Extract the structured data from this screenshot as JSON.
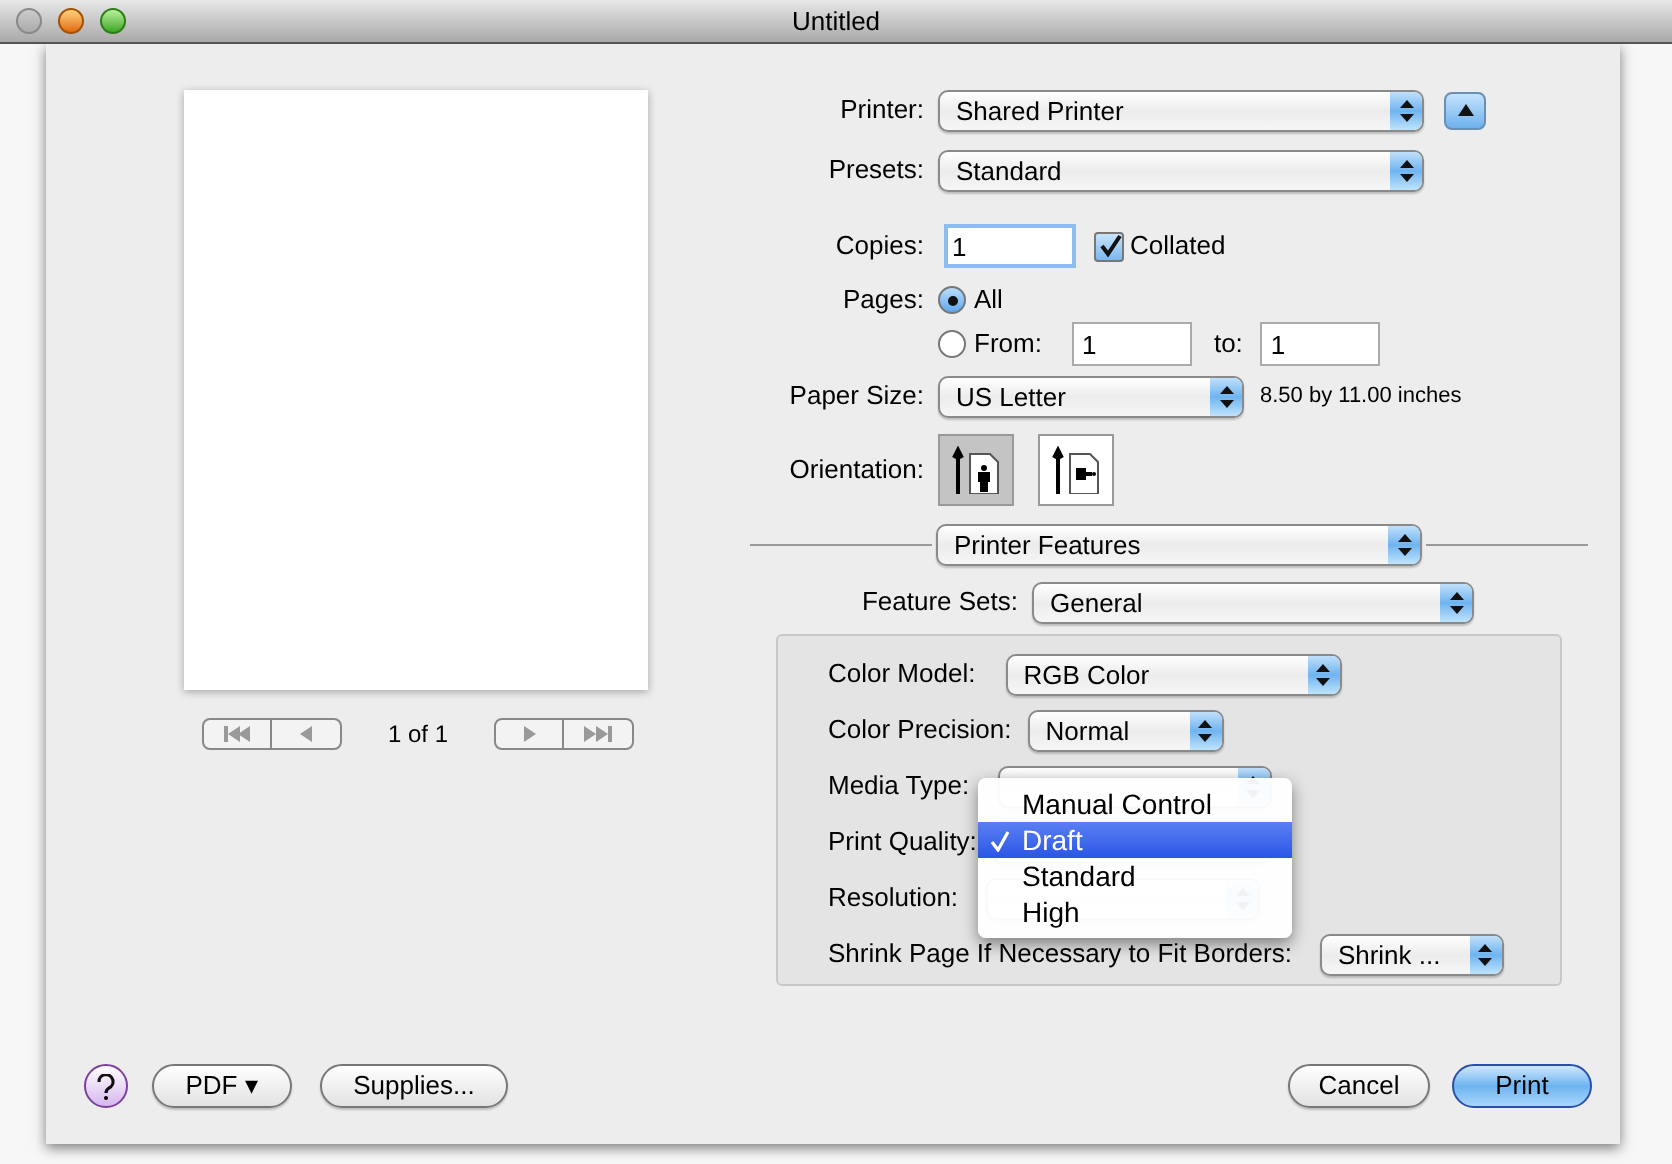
{
  "window": {
    "title": "Untitled"
  },
  "preview": {
    "page_indicator": "1 of 1"
  },
  "printer": {
    "label": "Printer:",
    "value": "Shared Printer"
  },
  "presets": {
    "label": "Presets:",
    "value": "Standard"
  },
  "copies": {
    "label": "Copies:",
    "value": "1"
  },
  "collated": {
    "label": "Collated",
    "checked": true
  },
  "pages": {
    "label": "Pages:",
    "options": [
      {
        "label": "All",
        "selected": true
      },
      {
        "label": "From:",
        "selected": false
      }
    ],
    "from_value": "1",
    "to_label": "to:",
    "to_value": "1"
  },
  "paper_size": {
    "label": "Paper Size:",
    "value": "US Letter",
    "dimensions": "8.50 by 11.00 inches"
  },
  "orientation": {
    "label": "Orientation:",
    "options": [
      {
        "kind": "portrait",
        "selected": true
      },
      {
        "kind": "landscape",
        "selected": false
      }
    ]
  },
  "panel_menu": {
    "value": "Printer Features"
  },
  "feature_sets": {
    "label": "Feature Sets:",
    "value": "General"
  },
  "features": [
    {
      "label": "Color Model:",
      "value": "RGB Color"
    },
    {
      "label": "Color Precision:",
      "value": "Normal"
    },
    {
      "label": "Media Type:"
    },
    {
      "label": "Print Quality:"
    },
    {
      "label": "Resolution:"
    },
    {
      "label": "Shrink Page If Necessary to Fit Borders:",
      "value": "Shrink ..."
    }
  ],
  "open_menu": {
    "items": [
      {
        "label": "Manual Control",
        "selected": false
      },
      {
        "label": "Draft",
        "selected": true
      },
      {
        "label": "Standard",
        "selected": false
      },
      {
        "label": "High",
        "selected": false
      }
    ]
  },
  "buttons": {
    "pdf": "PDF ▾",
    "supplies": "Supplies...",
    "cancel": "Cancel",
    "print": "Print"
  }
}
